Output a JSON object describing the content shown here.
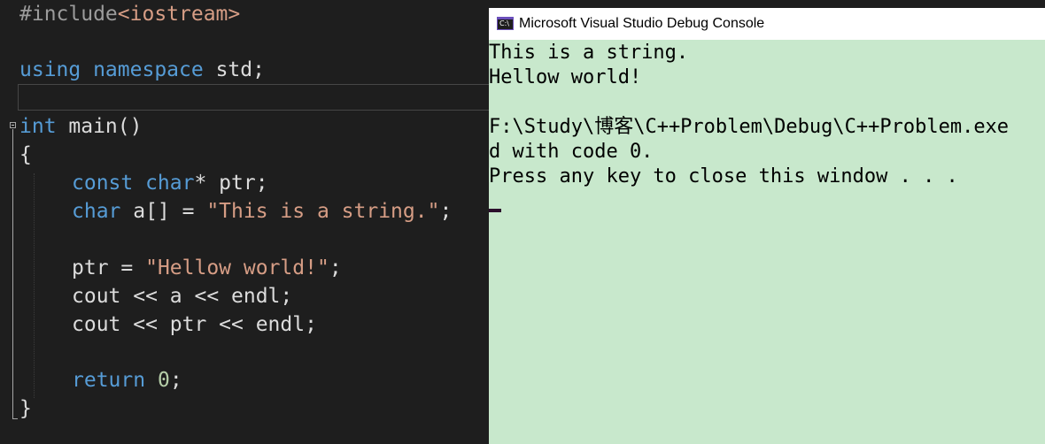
{
  "editor": {
    "lines": {
      "l1": {
        "pre": "#include",
        "inc": "<iostream>"
      },
      "l2": {
        "kw": "using namespace",
        "rest": " std;"
      },
      "l3": {
        "kw": "int",
        "rest": " main()"
      },
      "l4": {
        "text": "{"
      },
      "l5": {
        "kw1": "const char",
        "rest": "* ptr;"
      },
      "l6": {
        "kw": "char",
        "mid": " a[] = ",
        "str": "\"This is a string.\"",
        "end": ";"
      },
      "l7": {
        "pre": "ptr = ",
        "str": "\"Hellow world!\"",
        "end": ";"
      },
      "l8": {
        "text": "cout << a << endl;"
      },
      "l9": {
        "text": "cout << ptr << endl;"
      },
      "l10": {
        "kw": "return",
        "sp": " ",
        "num": "0",
        "end": ";"
      },
      "l11": {
        "text": "}"
      }
    }
  },
  "console": {
    "title": "Microsoft Visual Studio Debug Console",
    "icon_label": "C:\\",
    "icon": "console-window-icon",
    "lines": [
      "This is a string.",
      "Hellow world!",
      "",
      "F:\\Study\\博客\\C++Problem\\Debug\\C++Problem.exe",
      "d with code 0.",
      "Press any key to close this window . . ."
    ]
  },
  "colors": {
    "editor_bg": "#1e1e1e",
    "keyword": "#569cd6",
    "string": "#d69d85",
    "number": "#b5cea8",
    "console_bg": "#c8e8cc"
  }
}
